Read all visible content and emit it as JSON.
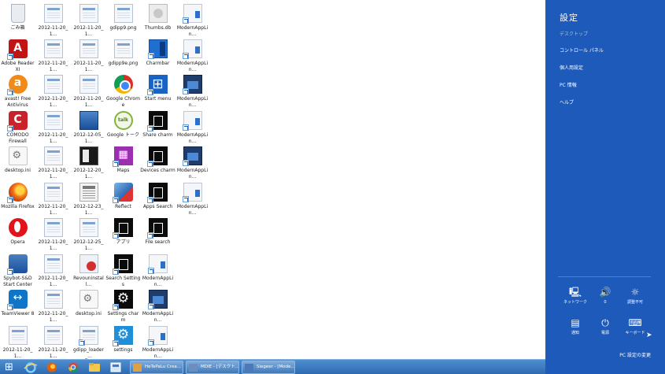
{
  "desktop": {
    "icons": [
      {
        "label": "ごみ箱",
        "icon": "recycle-bin-icon"
      },
      {
        "label": "2012-11-20_1...",
        "icon": "screenshot-file-icon"
      },
      {
        "label": "2012-11-20_1...",
        "icon": "screenshot-file-icon"
      },
      {
        "label": "gdipp9.png",
        "icon": "png-file-icon"
      },
      {
        "label": "Thumbs.db",
        "icon": "db-file-icon"
      },
      {
        "label": "ModernAppLin...",
        "icon": "modern-app-link-icon"
      },
      {
        "label": "Adobe Reader\nXI",
        "icon": "adobe-reader-icon"
      },
      {
        "label": "2012-11-20_1...",
        "icon": "screenshot-file-icon"
      },
      {
        "label": "2012-11-20_1...",
        "icon": "screenshot-file-icon"
      },
      {
        "label": "gdipp9e.png",
        "icon": "png-file-icon"
      },
      {
        "label": "Charmbar",
        "icon": "charmbar-icon"
      },
      {
        "label": "ModernAppLin...",
        "icon": "modern-app-link-icon"
      },
      {
        "label": "avast! Free\nAntivirus",
        "icon": "avast-icon"
      },
      {
        "label": "2012-11-20_1...",
        "icon": "screenshot-file-icon"
      },
      {
        "label": "2012-11-20_1...",
        "icon": "screenshot-file-icon"
      },
      {
        "label": "Google Chrome",
        "icon": "chrome-icon"
      },
      {
        "label": "Start menu",
        "icon": "start-menu-icon"
      },
      {
        "label": "ModernAppLin...",
        "icon": "modern-app-link-dark-icon"
      },
      {
        "label": "COMODO\nFirewall",
        "icon": "comodo-icon"
      },
      {
        "label": "2012-11-20_1...",
        "icon": "screenshot-file-icon"
      },
      {
        "label": "2012-12-05_1...",
        "icon": "screenshot-file-icon"
      },
      {
        "label": "Google トーク",
        "icon": "google-talk-icon"
      },
      {
        "label": "Share charm",
        "icon": "share-charm-icon"
      },
      {
        "label": "ModernAppLin...",
        "icon": "modern-app-link-icon"
      },
      {
        "label": "desktop.ini",
        "icon": "ini-file-icon"
      },
      {
        "label": "2012-11-20_1...",
        "icon": "screenshot-file-icon"
      },
      {
        "label": "2012-12-20_1...",
        "icon": "dark-file-icon"
      },
      {
        "label": "Maps",
        "icon": "maps-icon"
      },
      {
        "label": "Devices charm",
        "icon": "devices-charm-icon"
      },
      {
        "label": "ModernAppLin...",
        "icon": "modern-app-link-dark-icon"
      },
      {
        "label": "Mozilla Firefox",
        "icon": "firefox-icon"
      },
      {
        "label": "2012-11-20_1...",
        "icon": "screenshot-file-icon"
      },
      {
        "label": "2012-12-23_1...",
        "icon": "calendar-file-icon"
      },
      {
        "label": "Reflect",
        "icon": "reflect-icon"
      },
      {
        "label": "Apps Search",
        "icon": "apps-search-icon"
      },
      {
        "label": "ModernAppLin...",
        "icon": "modern-app-link-icon"
      },
      {
        "label": "Opera",
        "icon": "opera-icon"
      },
      {
        "label": "2012-11-20_1...",
        "icon": "screenshot-file-icon"
      },
      {
        "label": "2012-12-25_1...",
        "icon": "screenshot-file-icon"
      },
      {
        "label": "アプリ",
        "icon": "apps-icon"
      },
      {
        "label": "File search",
        "icon": "file-search-icon"
      },
      {
        "label": "Spybot-S&D\nStart Center",
        "icon": "spybot-icon"
      },
      {
        "label": "2012-11-20_1...",
        "icon": "screenshot-file-icon"
      },
      {
        "label": "Revouninstall...",
        "icon": "revo-uninstaller-icon"
      },
      {
        "label": "Search Settings",
        "icon": "search-settings-icon"
      },
      {
        "label": "ModernAppLin...",
        "icon": "modern-app-link-icon"
      },
      {
        "label": "TeamViewer 8",
        "icon": "teamviewer-icon"
      },
      {
        "label": "2012-11-20_1...",
        "icon": "screenshot-file-icon"
      },
      {
        "label": "desktop.ini",
        "icon": "ini-file-icon"
      },
      {
        "label": "Settings charm",
        "icon": "settings-charm-icon"
      },
      {
        "label": "ModernAppLin...",
        "icon": "modern-app-link-dark-icon"
      },
      {
        "label": "2012-11-20_1...",
        "icon": "screenshot-file-icon"
      },
      {
        "label": "2012-11-20_1...",
        "icon": "screenshot-file-icon"
      },
      {
        "label": "gdipp_loader_...\n- ショートカット",
        "icon": "gdipp-loader-shortcut-icon"
      },
      {
        "label": "settings",
        "icon": "settings-icon"
      },
      {
        "label": "ModernAppLin...",
        "icon": "modern-app-link-icon"
      }
    ]
  },
  "charm_panel": {
    "title": "設定",
    "subtitle": "デスクトップ",
    "links": [
      "コントロール パネル",
      "個人用設定",
      "PC 情報",
      "ヘルプ"
    ],
    "quick_settings": [
      {
        "label": "ネットワーク",
        "icon": "network-icon",
        "glyph": "🖳"
      },
      {
        "label": "0",
        "icon": "volume-icon",
        "glyph": "🔊"
      },
      {
        "label": "調整不可",
        "icon": "brightness-icon",
        "glyph": "☼"
      },
      {
        "label": "通知",
        "icon": "notifications-icon",
        "glyph": "▤"
      },
      {
        "label": "電源",
        "icon": "power-icon",
        "glyph": "⏻"
      },
      {
        "label": "キーボード",
        "icon": "keyboard-icon",
        "glyph": "⌨"
      }
    ],
    "footer_link": "PC 設定の変更",
    "accent_color": "#1e5aba"
  },
  "taskbar": {
    "pinned": [
      "start-button",
      "internet-explorer-icon",
      "firefox-icon",
      "chrome-icon",
      "explorer-icon",
      "app-icon"
    ],
    "windows": [
      {
        "title": "HeTePaLu Crea..."
      },
      {
        "title": "MDIE - [デスクト..."
      },
      {
        "title": "Siegeer - [Mode..."
      }
    ]
  }
}
